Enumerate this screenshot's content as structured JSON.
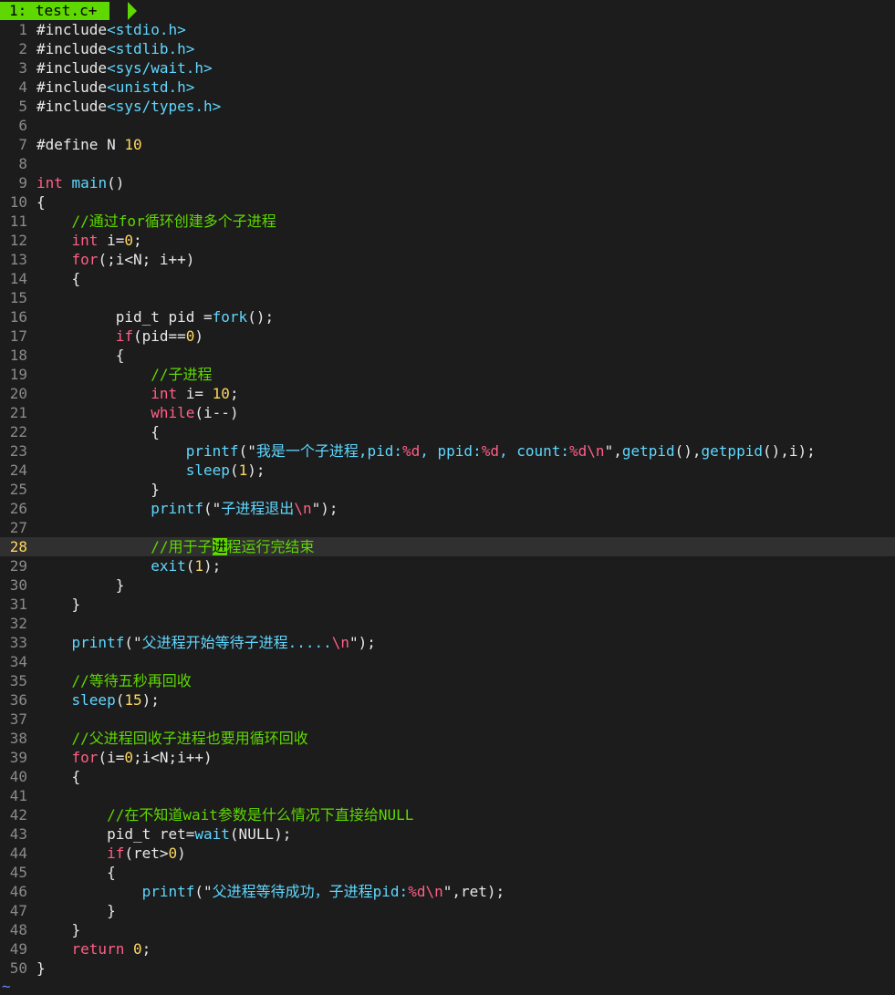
{
  "tab": {
    "label": "1: test.c+"
  },
  "cursor_line": 28,
  "end_marker": "~",
  "colors": {
    "background": "#1c1c1c",
    "tab_active": "#5fd700",
    "keyword": "#ff5f87",
    "function": "#5fd7ff",
    "number": "#ffd75f",
    "comment": "#5fd700",
    "line_number": "#8a8a8a"
  },
  "lines": [
    {
      "n": "1",
      "t": [
        [
          "pre",
          "#include"
        ],
        [
          "hdr",
          "<stdio.h>"
        ]
      ]
    },
    {
      "n": "2",
      "t": [
        [
          "pre",
          "#include"
        ],
        [
          "hdr",
          "<stdlib.h>"
        ]
      ]
    },
    {
      "n": "3",
      "t": [
        [
          "pre",
          "#include"
        ],
        [
          "hdr",
          "<sys/wait.h>"
        ]
      ]
    },
    {
      "n": "4",
      "t": [
        [
          "pre",
          "#include"
        ],
        [
          "hdr",
          "<unistd.h>"
        ]
      ]
    },
    {
      "n": "5",
      "t": [
        [
          "pre",
          "#include"
        ],
        [
          "hdr",
          "<sys/types.h>"
        ]
      ]
    },
    {
      "n": "6",
      "t": []
    },
    {
      "n": "7",
      "t": [
        [
          "pre",
          "#define N "
        ],
        [
          "num",
          "10"
        ]
      ]
    },
    {
      "n": "8",
      "t": []
    },
    {
      "n": "9",
      "t": [
        [
          "type",
          "int"
        ],
        [
          "p",
          " "
        ],
        [
          "fn",
          "main"
        ],
        [
          "p",
          "()"
        ]
      ]
    },
    {
      "n": "10",
      "t": [
        [
          "p",
          "{"
        ]
      ]
    },
    {
      "n": "11",
      "t": [
        [
          "p",
          "    "
        ],
        [
          "cm",
          "//通过for循环创建多个子进程"
        ]
      ]
    },
    {
      "n": "12",
      "t": [
        [
          "p",
          "    "
        ],
        [
          "type",
          "int"
        ],
        [
          "p",
          " i="
        ],
        [
          "num",
          "0"
        ],
        [
          "p",
          ";"
        ]
      ]
    },
    {
      "n": "13",
      "t": [
        [
          "p",
          "    "
        ],
        [
          "kw",
          "for"
        ],
        [
          "p",
          "(;i<N; i++)"
        ]
      ]
    },
    {
      "n": "14",
      "t": [
        [
          "p",
          "    {"
        ]
      ]
    },
    {
      "n": "15",
      "t": []
    },
    {
      "n": "16",
      "t": [
        [
          "p",
          "         pid_t pid ="
        ],
        [
          "fn",
          "fork"
        ],
        [
          "p",
          "();"
        ]
      ]
    },
    {
      "n": "17",
      "t": [
        [
          "p",
          "         "
        ],
        [
          "kw",
          "if"
        ],
        [
          "p",
          "(pid=="
        ],
        [
          "num",
          "0"
        ],
        [
          "p",
          ")"
        ]
      ]
    },
    {
      "n": "18",
      "t": [
        [
          "p",
          "         {"
        ]
      ]
    },
    {
      "n": "19",
      "t": [
        [
          "p",
          "             "
        ],
        [
          "cm",
          "//子进程"
        ]
      ]
    },
    {
      "n": "20",
      "t": [
        [
          "p",
          "             "
        ],
        [
          "type",
          "int"
        ],
        [
          "p",
          " i= "
        ],
        [
          "num",
          "10"
        ],
        [
          "p",
          ";"
        ]
      ]
    },
    {
      "n": "21",
      "t": [
        [
          "p",
          "             "
        ],
        [
          "kw",
          "while"
        ],
        [
          "p",
          "(i--)"
        ]
      ]
    },
    {
      "n": "22",
      "t": [
        [
          "p",
          "             {"
        ]
      ]
    },
    {
      "n": "23",
      "t": [
        [
          "p",
          "                 "
        ],
        [
          "fn",
          "printf"
        ],
        [
          "p",
          "(\""
        ],
        [
          "str",
          "我是一个子进程,pid:"
        ],
        [
          "esc",
          "%d"
        ],
        [
          "str",
          ", ppid:"
        ],
        [
          "esc",
          "%d"
        ],
        [
          "str",
          ", count:"
        ],
        [
          "esc",
          "%d\\n"
        ],
        [
          "p",
          "\","
        ],
        [
          "fn",
          "getpid"
        ],
        [
          "p",
          "(),"
        ],
        [
          "fn",
          "getppid"
        ],
        [
          "p",
          "(),i);"
        ]
      ]
    },
    {
      "n": "24",
      "t": [
        [
          "p",
          "                 "
        ],
        [
          "fn",
          "sleep"
        ],
        [
          "p",
          "("
        ],
        [
          "num",
          "1"
        ],
        [
          "p",
          ");"
        ]
      ]
    },
    {
      "n": "25",
      "t": [
        [
          "p",
          "             }"
        ]
      ]
    },
    {
      "n": "26",
      "t": [
        [
          "p",
          "             "
        ],
        [
          "fn",
          "printf"
        ],
        [
          "p",
          "(\""
        ],
        [
          "str",
          "子进程退出"
        ],
        [
          "esc",
          "\\n"
        ],
        [
          "p",
          "\");"
        ]
      ]
    },
    {
      "n": "27",
      "t": []
    },
    {
      "n": "28",
      "t": [
        [
          "p",
          "             "
        ],
        [
          "cm",
          "//用于子"
        ],
        [
          "cmhl",
          "进"
        ],
        [
          "cm",
          "程运行完结束"
        ]
      ]
    },
    {
      "n": "29",
      "t": [
        [
          "p",
          "             "
        ],
        [
          "fn",
          "exit"
        ],
        [
          "p",
          "("
        ],
        [
          "num",
          "1"
        ],
        [
          "p",
          ");"
        ]
      ]
    },
    {
      "n": "30",
      "t": [
        [
          "p",
          "         }"
        ]
      ]
    },
    {
      "n": "31",
      "t": [
        [
          "p",
          "    }"
        ]
      ]
    },
    {
      "n": "32",
      "t": []
    },
    {
      "n": "33",
      "t": [
        [
          "p",
          "    "
        ],
        [
          "fn",
          "printf"
        ],
        [
          "p",
          "(\""
        ],
        [
          "str",
          "父进程开始等待子进程....."
        ],
        [
          "esc",
          "\\n"
        ],
        [
          "p",
          "\");"
        ]
      ]
    },
    {
      "n": "34",
      "t": []
    },
    {
      "n": "35",
      "t": [
        [
          "p",
          "    "
        ],
        [
          "cm",
          "//等待五秒再回收"
        ]
      ]
    },
    {
      "n": "36",
      "t": [
        [
          "p",
          "    "
        ],
        [
          "fn",
          "sleep"
        ],
        [
          "p",
          "("
        ],
        [
          "num",
          "15"
        ],
        [
          "p",
          ");"
        ]
      ]
    },
    {
      "n": "37",
      "t": []
    },
    {
      "n": "38",
      "t": [
        [
          "p",
          "    "
        ],
        [
          "cm",
          "//父进程回收子进程也要用循环回收"
        ]
      ]
    },
    {
      "n": "39",
      "t": [
        [
          "p",
          "    "
        ],
        [
          "kw",
          "for"
        ],
        [
          "p",
          "(i="
        ],
        [
          "num",
          "0"
        ],
        [
          "p",
          ";i<N;i++)"
        ]
      ]
    },
    {
      "n": "40",
      "t": [
        [
          "p",
          "    {"
        ]
      ]
    },
    {
      "n": "41",
      "t": []
    },
    {
      "n": "42",
      "t": [
        [
          "p",
          "        "
        ],
        [
          "cm",
          "//在不知道wait参数是什么情况下直接给NULL"
        ]
      ]
    },
    {
      "n": "43",
      "t": [
        [
          "p",
          "        pid_t ret="
        ],
        [
          "fn",
          "wait"
        ],
        [
          "p",
          "(NULL);"
        ]
      ]
    },
    {
      "n": "44",
      "t": [
        [
          "p",
          "        "
        ],
        [
          "kw",
          "if"
        ],
        [
          "p",
          "(ret>"
        ],
        [
          "num",
          "0"
        ],
        [
          "p",
          ")"
        ]
      ]
    },
    {
      "n": "45",
      "t": [
        [
          "p",
          "        {"
        ]
      ]
    },
    {
      "n": "46",
      "t": [
        [
          "p",
          "            "
        ],
        [
          "fn",
          "printf"
        ],
        [
          "p",
          "(\""
        ],
        [
          "str",
          "父进程等待成功，子进程pid:"
        ],
        [
          "esc",
          "%d\\n"
        ],
        [
          "p",
          "\",ret);"
        ]
      ]
    },
    {
      "n": "47",
      "t": [
        [
          "p",
          "        }"
        ]
      ]
    },
    {
      "n": "48",
      "t": [
        [
          "p",
          "    }"
        ]
      ]
    },
    {
      "n": "49",
      "t": [
        [
          "p",
          "    "
        ],
        [
          "kw",
          "return"
        ],
        [
          "p",
          " "
        ],
        [
          "num",
          "0"
        ],
        [
          "p",
          ";"
        ]
      ]
    },
    {
      "n": "50",
      "t": [
        [
          "p",
          "}"
        ]
      ]
    }
  ]
}
